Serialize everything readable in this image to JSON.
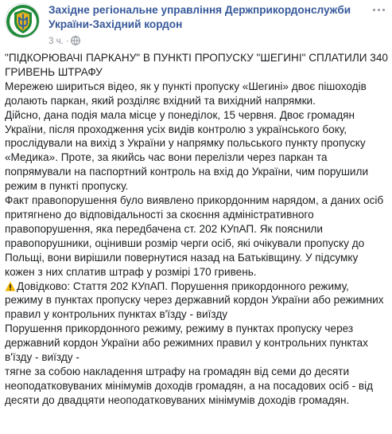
{
  "post": {
    "page_name": "Західне регіональне управління Держприкордонслужби України-Західний кордон",
    "time": "3 ч.",
    "separator": "·",
    "paragraphs": [
      "\"ПІДКОРЮВАЧІ ПАРКАНУ\" В ПУНКТІ ПРОПУСКУ \"ШЕГИНІ\" СПЛАТИЛИ 340 ГРИВЕНЬ ШТРАФУ",
      "Мережею шириться відео, як у пункті пропуску «Шегині» двоє пішоходів долають паркан, який розділяє вхідний та вихідний напрямки.",
      "Дійсно, дана подія мала місце у понеділок, 15 червня. Двоє громадян України, після проходження усіх видів контролю з українського боку, прослідували на вихід з України у напрямку польського пункту пропуску «Медика». Проте, за якийсь час вони перелізли через паркан та попрямували на паспортний контроль на вхід до України, чим порушили режим в пункті пропуску.",
      "Факт правопорушення було виявлено прикордонним нарядом, а даних осіб притягнено до відповідальності за скоєння адміністративного правопорушення, яка передбачена ст. 202 КУпАП. Як пояснили правопорушники, оцінивши розмір черги осіб, які очікували пропуску до Польщі, вони вирішили повернутися назад на Батьківщину. У підсумку кожен з них сплатив штраф у розмірі 170 гривень.",
      "Довідково: Стаття 202 КУпАП. Порушення прикордонного режиму, режиму в пунктах пропуску через державний кордон України або режимних правил у контрольних пунктах в'їзду - виїзду",
      "Порушення прикордонного режиму, режиму в пунктах пропуску через державний кордон України або режимних правил у контрольних пунктах в'їзду - виїзду -",
      "тягне за собою накладення штрафу на громадян від семи до десяти неоподатковуваних мінімумів доходів громадян, а на посадових осіб - від десяти до двадцяти неоподатковуваних мінімумів доходів громадян."
    ]
  },
  "icons": {
    "avatar": "border-guard-emblem",
    "privacy": "globe-icon",
    "menu": "more-options-icon",
    "notice": "warning-icon"
  },
  "colors": {
    "page_name": "#365899",
    "meta": "#90949c",
    "text": "#1c1e21",
    "emblem_green": "#1f8a3a",
    "emblem_gold": "#e0b020",
    "warning": "#f5b400"
  }
}
